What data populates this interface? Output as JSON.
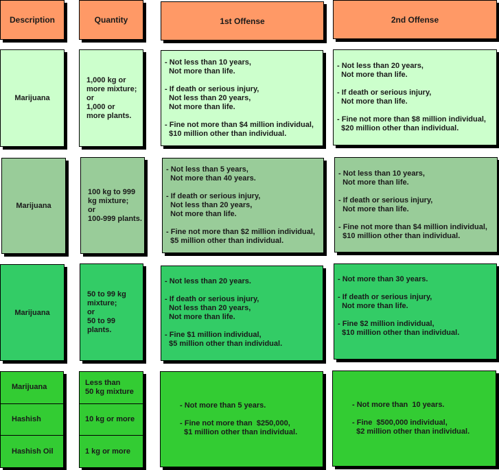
{
  "colors": {
    "header": "#ff9966",
    "tier1": "#ccffcc",
    "tier2": "#99cc99",
    "tier3": "#33cc66",
    "tier4": "#33cc33"
  },
  "headers": {
    "description": "Description",
    "quantity": "Quantity",
    "first_offense": "1st Offense",
    "second_offense": "2nd Offense"
  },
  "rows": [
    {
      "description": "Marijuana",
      "quantity": [
        "1,000 kg or",
        "more mixture;",
        "or",
        "1,000 or",
        "more plants."
      ],
      "first": [
        [
          "- Not less than 10 years,",
          "  Not more than life."
        ],
        [
          "- If death or serious injury,",
          "  Not less than 20 years,",
          "  Not more than life."
        ],
        [
          "- Fine not more than $4 million individual,",
          "  $10 million other than individual."
        ]
      ],
      "second": [
        [
          "- Not less than 20 years,",
          "  Not more than life."
        ],
        [
          "- If death or serious injury,",
          "  Not more than life."
        ],
        [
          "- Fine not more than $8 million individual,",
          "  $20 million other than individual."
        ]
      ]
    },
    {
      "description": "Marijuana",
      "quantity": [
        "100 kg to 999",
        "kg mixture;",
        "or",
        "100-999 plants."
      ],
      "first": [
        [
          "- Not less than 5 years,",
          "  Not more than 40 years."
        ],
        [
          "- If death or serious injury,",
          "  Not less than 20 years,",
          "  Not more than life."
        ],
        [
          "- Fine not more than $2 million individual,",
          "  $5 million other than individual."
        ]
      ],
      "second": [
        [
          "- Not less than 10 years,",
          "  Not more than life."
        ],
        [
          "- If death or serious injury,",
          "  Not more than life."
        ],
        [
          "- Fine not more than $4 million individual,",
          "  $10 million other than individual."
        ]
      ]
    },
    {
      "description": "Marijuana",
      "quantity": [
        "50 to 99 kg",
        "mixture;",
        "or",
        "50 to 99",
        "plants."
      ],
      "first": [
        [
          "- Not less than 20 years."
        ],
        [
          "- If death or serious injury,",
          "  Not less than 20 years,",
          "  Not more than life."
        ],
        [
          "- Fine $1 million individual,",
          "  $5 million other than individual."
        ]
      ],
      "second": [
        [
          "- Not more than 30 years."
        ],
        [
          "- If death or serious injury,",
          "  Not more than life."
        ],
        [
          "- Fine $2 million individual,",
          "  $10 million other than individual."
        ]
      ]
    },
    {
      "descriptions": [
        "Marijuana",
        "Hashish",
        "Hashish Oil"
      ],
      "quantities": [
        [
          "Less than",
          "50 kg mixture"
        ],
        [
          "10 kg or more"
        ],
        [
          "1 kg or more"
        ]
      ],
      "first": [
        [
          "- Not more than 5 years."
        ],
        [
          "- Fine not more than  $250,000,",
          "  $1 million other than individual."
        ]
      ],
      "second": [
        [
          "- Not more than  10 years."
        ],
        [
          "- Fine  $500,000 individual,",
          "  $2 million other than individual."
        ]
      ]
    }
  ]
}
